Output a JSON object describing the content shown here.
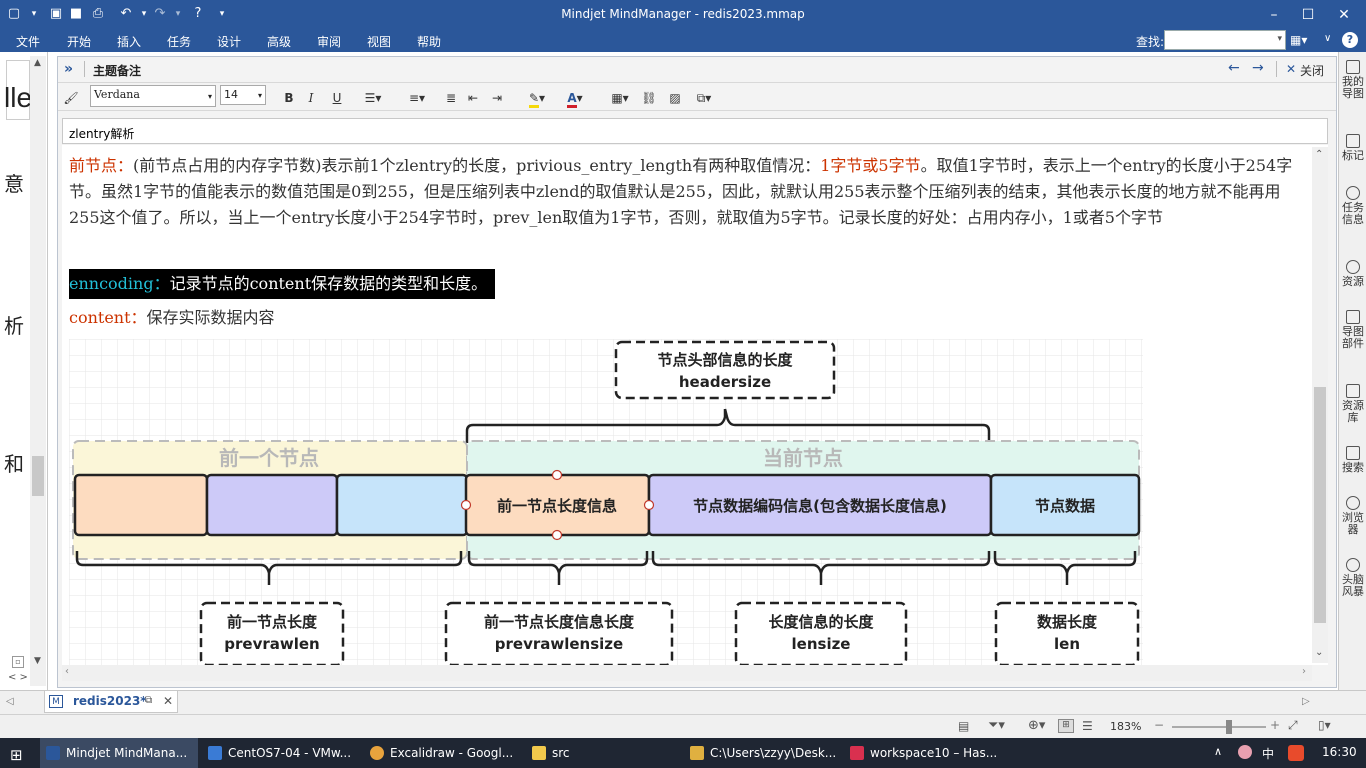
{
  "window": {
    "title": "Mindjet MindManager - redis2023.mmap"
  },
  "menu": [
    "文件",
    "开始",
    "插入",
    "任务",
    "设计",
    "高级",
    "审阅",
    "视图",
    "帮助"
  ],
  "search": {
    "label": "查找:",
    "value": ""
  },
  "notes_panel": {
    "header_title": "主题备注",
    "close_label": "关闭",
    "font_name": "Verdana",
    "font_size": "14",
    "bold": "B",
    "italic": "I",
    "underline": "U",
    "topic_title": "zlentry解析"
  },
  "content": {
    "p1_label": "前节点：",
    "p1_a": "(前节点占用的内存字节数)表示前1个zlentry的长度，privious_entry_length有两种取值情况：",
    "p1_red": "1字节或5字节",
    "p1_b": "。取值1字节时，表示上一个entry的长度小于254字节。虽然1字节的值能表示的数值范围是0到255，但是压缩列表中zlend的取值默认是255，因此，就默认用255表示整个压缩列表的结束，其他表示长度的地方就不能再用255这个值了。所以，当上一个entry长度小于254字节时，prev_len取值为1字节，否则，就取值为5字节。记录长度的好处：占用内存小，1或者5个字节",
    "p2_label": "enncoding：",
    "p2_text": "记录节点的content保存数据的类型和长度。",
    "p3_label": "content：",
    "p3_text": "保存实际数据内容"
  },
  "diagram": {
    "header_box_line1": "节点头部信息的长度",
    "header_box_line2": "headersize",
    "prev_group": "前一个节点",
    "current_group": "当前节点",
    "cell_prevlen": "前一节点长度信息",
    "cell_encoding": "节点数据编码信息(包含数据长度信息)",
    "cell_data": "节点数据",
    "box1_line1": "前一节点长度",
    "box1_line2": "prevrawlen",
    "box2_line1": "前一节点长度信息长度",
    "box2_line2": "prevrawlensize",
    "box3_line1": "长度信息的长度",
    "box3_line2": "lensize",
    "box4_line1": "数据长度",
    "box4_line2": "len"
  },
  "left_fragments": [
    "lle",
    "意",
    "析",
    "和"
  ],
  "right_panel": [
    "我的导图",
    "标记",
    "任务信息",
    "资源",
    "导图部件",
    "资源库",
    "搜索",
    "浏览器",
    "头脑风暴"
  ],
  "doc_tab": {
    "label": "redis2023*"
  },
  "status": {
    "zoom": "183%"
  },
  "taskbar": {
    "items": [
      {
        "label": "Mindjet MindMana...",
        "color": "#2b579a"
      },
      {
        "label": "CentOS7-04 - VMw...",
        "color": "#3a7bd5"
      },
      {
        "label": "Excalidraw - Googl...",
        "color": "#e8a33d"
      },
      {
        "label": "src",
        "color": "#f2c94c"
      },
      {
        "label": "C:\\Users\\zzyy\\Desk...",
        "color": "#e0b040"
      },
      {
        "label": "workspace10 – Has...",
        "color": "#d9304f"
      }
    ],
    "ime": "中",
    "time": "16:30"
  },
  "colors": {
    "accent": "#2b579a",
    "red_text": "#cc3300",
    "cyan_text": "#22c0d8"
  }
}
